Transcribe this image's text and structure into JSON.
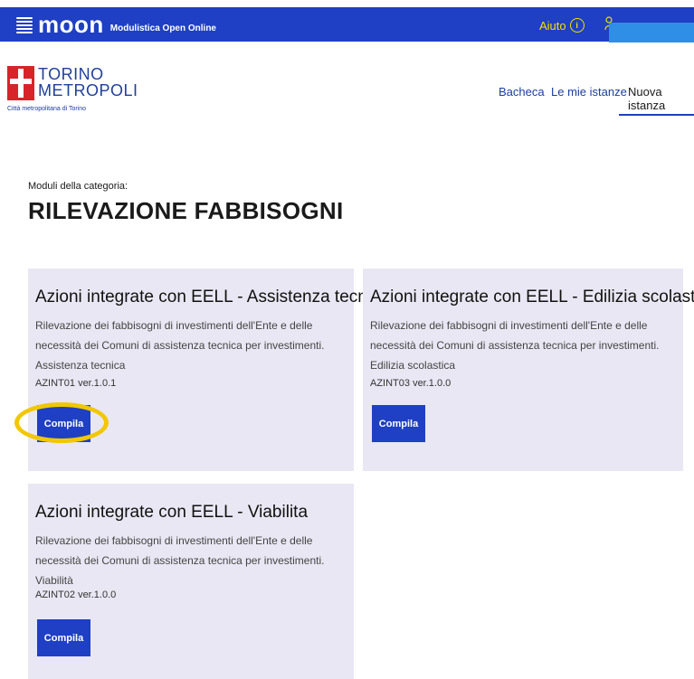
{
  "topbar": {
    "brand_name": "moon",
    "brand_subtitle": "Modulistica Open Online",
    "help_label": "Aiuto",
    "help_icon_glyph": "i",
    "user_icon_glyph": "&",
    "bar_color": "#1f3fc4",
    "accent_color": "#f4e000"
  },
  "header": {
    "logo_line1": "TORINO",
    "logo_line2": "METROPOLI",
    "logo_caption": "Città metropolitana di Torino",
    "nav": [
      {
        "label": "Bacheca"
      },
      {
        "label": "Le mie istanze"
      },
      {
        "label": "Nuova istanza"
      }
    ]
  },
  "main": {
    "category_label": "Moduli della categoria:",
    "category_title": "RILEVAZIONE FABBISOGNI",
    "cards": [
      {
        "title": "Azioni integrate con EELL - Assistenza tecnica",
        "description": "Rilevazione dei fabbisogni di investimenti dell'Ente e delle necessità dei Comuni di assistenza tecnica per investimenti. Assistenza tecnica",
        "code": "AZINT01 ver.1.0.1",
        "button": "Compila"
      },
      {
        "title": "Azioni integrate con EELL - Edilizia scolastica",
        "description": "Rilevazione dei fabbisogni di investimenti dell'Ente e delle necessità dei Comuni di assistenza tecnica per investimenti. Edilizia scolastica",
        "code": "AZINT03 ver.1.0.0",
        "button": "Compila"
      },
      {
        "title": "Azioni integrate con EELL - Viabilita",
        "description": "Rilevazione dei fabbisogni di investimenti dell'Ente e delle necessità dei Comuni di assistenza tecnica per investimenti. Viabilità",
        "code": "AZINT02 ver.1.0.0",
        "button": "Compila"
      }
    ]
  }
}
